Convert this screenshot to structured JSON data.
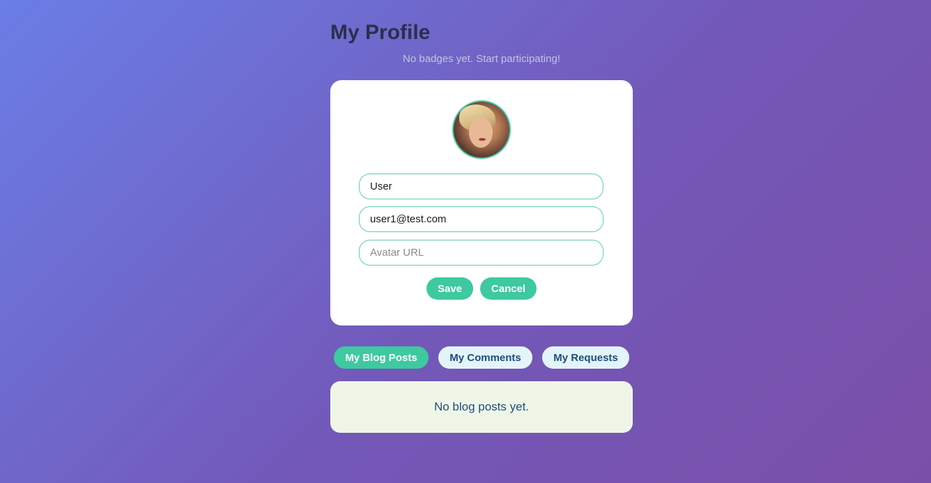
{
  "header": {
    "title": "My Profile",
    "badges_note": "No badges yet. Start participating!"
  },
  "profile_form": {
    "avatar_icon": "user-avatar-photo",
    "name_value": "User",
    "email_value": "user1@test.com",
    "avatar_url_value": "",
    "avatar_url_placeholder": "Avatar URL",
    "save_label": "Save",
    "cancel_label": "Cancel"
  },
  "tabs": [
    {
      "label": "My Blog Posts",
      "active": true
    },
    {
      "label": "My Comments",
      "active": false
    },
    {
      "label": "My Requests",
      "active": false
    }
  ],
  "content": {
    "empty_message": "No blog posts yet."
  },
  "colors": {
    "accent": "#3ec9a0",
    "tab_inactive_bg": "#e3f4fb",
    "tab_inactive_text": "#1d4e7a",
    "panel_bg": "#eff6e8",
    "title_text": "#2c2f4c"
  }
}
